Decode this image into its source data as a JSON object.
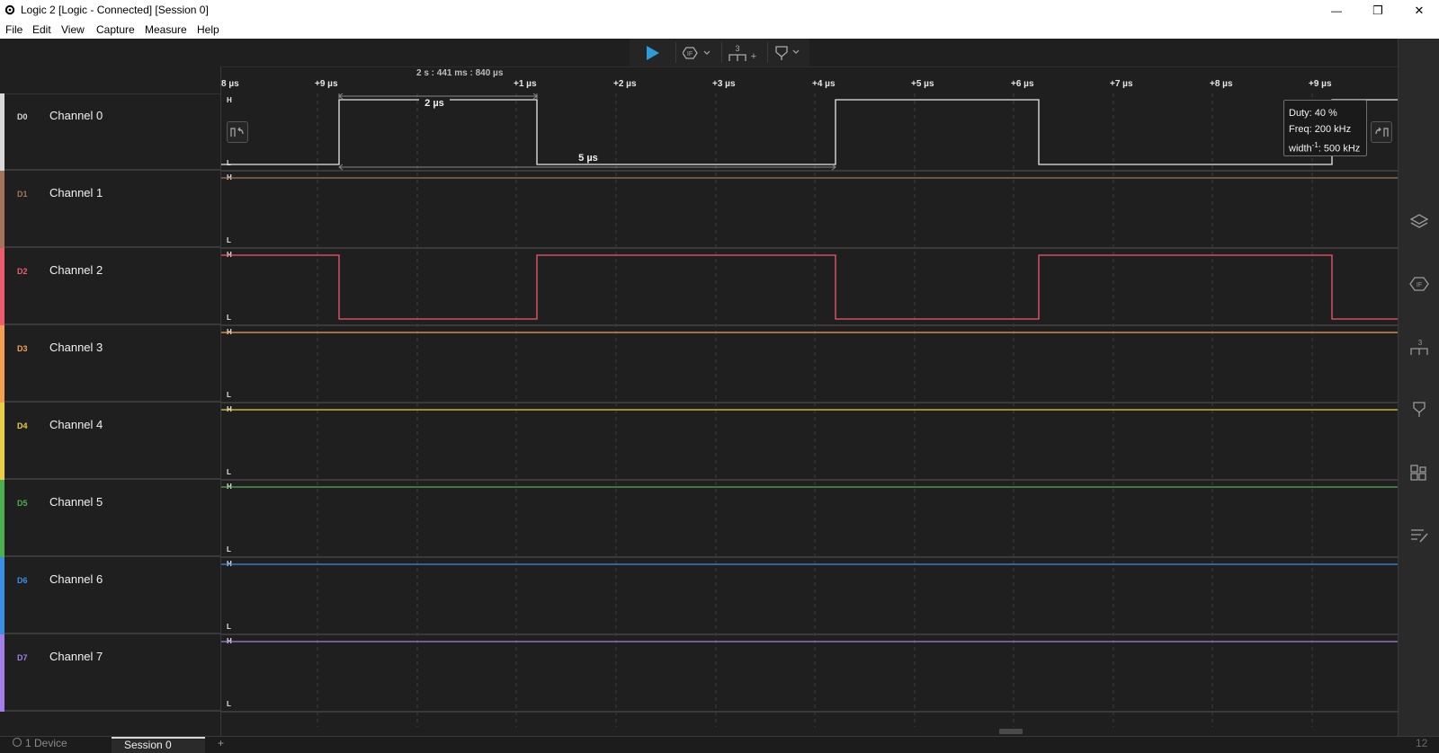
{
  "window": {
    "title": "Logic 2 [Logic - Connected] [Session 0]",
    "minimize_glyph": "—",
    "restore_glyph": "❐",
    "close_glyph": "✕"
  },
  "menu": [
    "File",
    "Edit",
    "View",
    "Capture",
    "Measure",
    "Help"
  ],
  "toolbar": {
    "play_icon": "play-icon",
    "trigger_icon": "trigger-icon",
    "timing_marker_label": "3",
    "timing_marker_plus": "+",
    "marker_icon": "marker-icon"
  },
  "timeline": {
    "reference_time": "2 s : 441 ms : 840 µs",
    "ticks": [
      "8 µs",
      "+9 µs",
      "+1 µs",
      "+2 µs",
      "+3 µs",
      "+4 µs",
      "+5 µs",
      "+6 µs",
      "+7 µs",
      "+8 µs",
      "+9 µs"
    ]
  },
  "channels": [
    {
      "id": "D0",
      "name": "Channel 0",
      "color": "#d9d9d9"
    },
    {
      "id": "D1",
      "name": "Channel 1",
      "color": "#a5735a"
    },
    {
      "id": "D2",
      "name": "Channel 2",
      "color": "#f05a6e"
    },
    {
      "id": "D3",
      "name": "Channel 3",
      "color": "#f5a050"
    },
    {
      "id": "D4",
      "name": "Channel 4",
      "color": "#e8d040"
    },
    {
      "id": "D5",
      "name": "Channel 5",
      "color": "#4caf50"
    },
    {
      "id": "D6",
      "name": "Channel 6",
      "color": "#3a8ee6"
    },
    {
      "id": "D7",
      "name": "Channel 7",
      "color": "#a47ee8"
    }
  ],
  "level_labels": {
    "high": "H",
    "low": "L"
  },
  "measurements": {
    "pulse_width": "2 µs",
    "period": "5 µs"
  },
  "tooltip": {
    "duty": "Duty: 40 %",
    "freq": "Freq: 200 kHz",
    "width": "width",
    "width_sup": "-1",
    "width_value": ": 500 kHz"
  },
  "sidebar_icons": [
    "analyzers-icon",
    "trigger-icon",
    "timing-markers-icon",
    "marker-icon",
    "extensions-icon",
    "notes-icon"
  ],
  "bottom": {
    "devices_label": "1 Device",
    "session_tab": "Session 0",
    "add_tab": "+",
    "right_info": "12"
  },
  "colors": {
    "background": "#1f1f1f",
    "accent": "#2d9cdb"
  }
}
